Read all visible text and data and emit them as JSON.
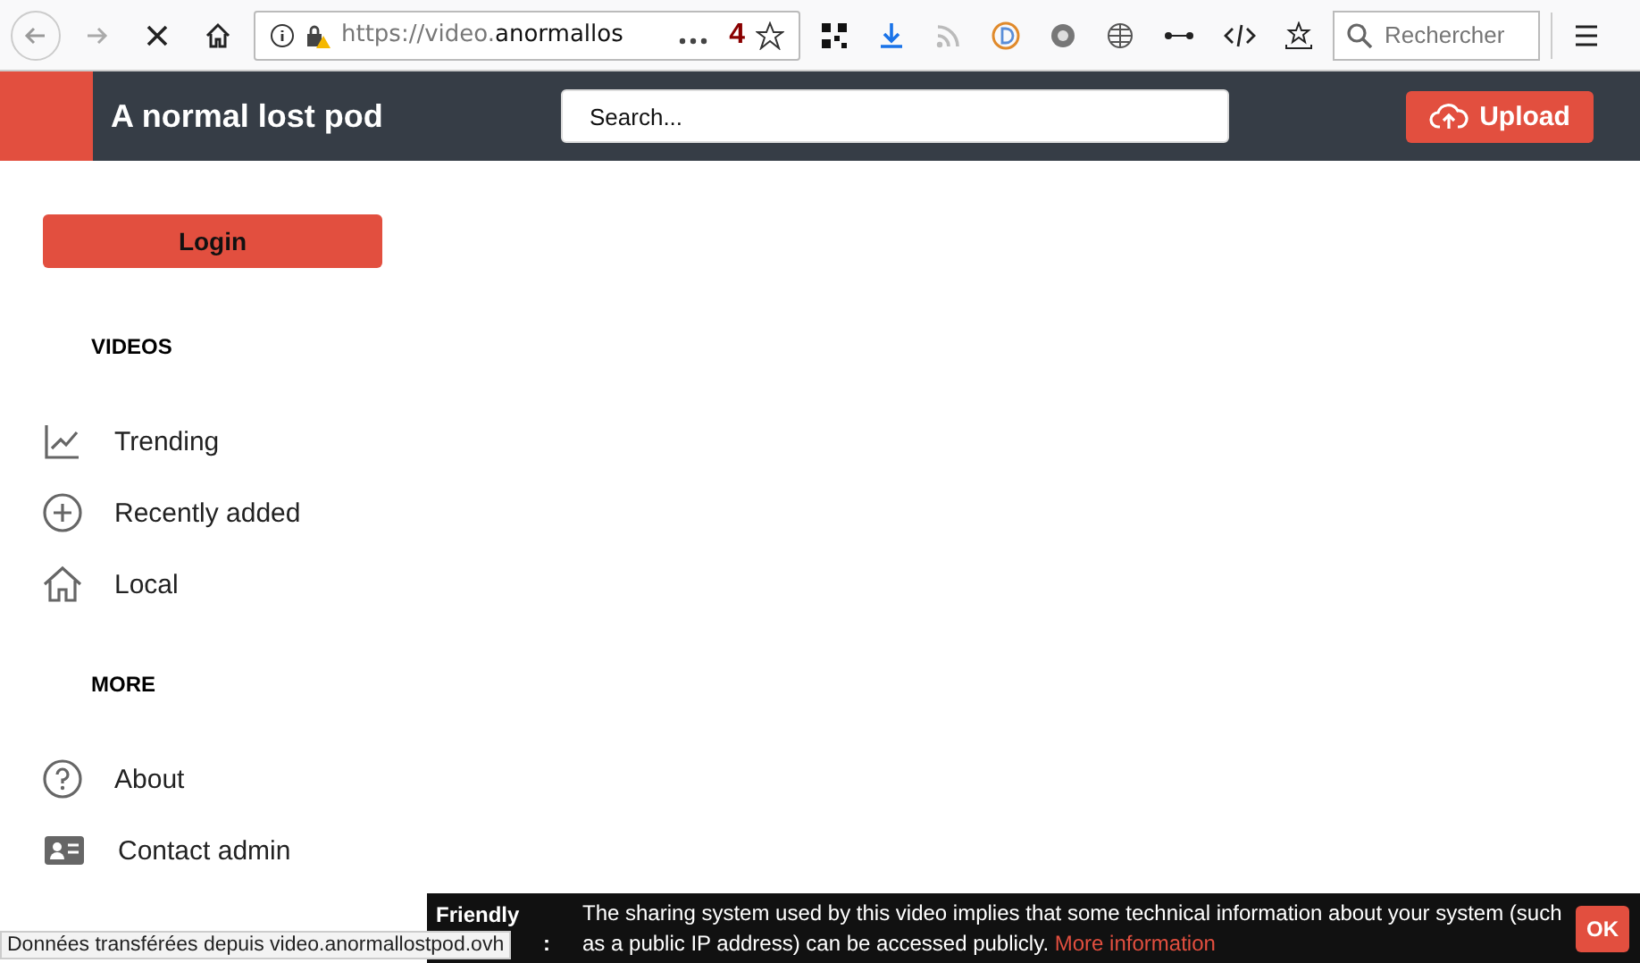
{
  "browser": {
    "url_prefix": "https://video.",
    "url_host": "anormallos",
    "badge": "4",
    "search_placeholder": "Rechercher",
    "loading": true
  },
  "header": {
    "title": "A normal lost pod",
    "search_placeholder": "Search...",
    "upload": "Upload"
  },
  "sidebar": {
    "login": "Login",
    "sections": [
      {
        "title": "VIDEOS",
        "items": [
          {
            "label": "Trending",
            "kind": "trending"
          },
          {
            "label": "Recently added",
            "kind": "recent"
          },
          {
            "label": "Local",
            "kind": "local"
          }
        ]
      },
      {
        "title": "MORE",
        "items": [
          {
            "label": "About",
            "kind": "about"
          },
          {
            "label": "Contact admin",
            "kind": "contact"
          }
        ]
      }
    ]
  },
  "cookie_banner": {
    "label": "Friendly",
    "colon": ":",
    "text": "The sharing system used by this video implies that some technical information about your system (such as a public IP address) can be accessed publicly.",
    "link": "More information",
    "ok": "OK"
  },
  "status_bar": "Données transférées depuis video.anormallostpod.ovh"
}
